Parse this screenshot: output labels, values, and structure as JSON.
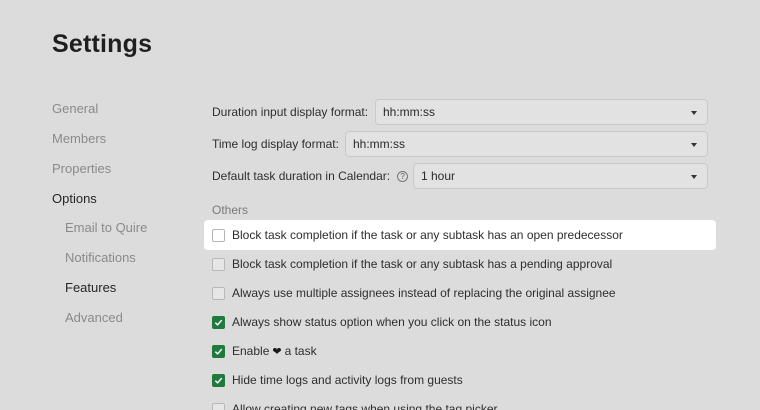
{
  "page": {
    "title": "Settings"
  },
  "sidebar": {
    "items": [
      {
        "label": "General",
        "active": false
      },
      {
        "label": "Members",
        "active": false
      },
      {
        "label": "Properties",
        "active": false
      },
      {
        "label": "Options",
        "active": true
      },
      {
        "label": "Email to Quire",
        "active": false
      },
      {
        "label": "Notifications",
        "active": false
      },
      {
        "label": "Features",
        "active": true
      },
      {
        "label": "Advanced",
        "active": false
      }
    ]
  },
  "fields": [
    {
      "label": "Duration input display format:",
      "value": "hh:mm:ss"
    },
    {
      "label": "Time log display format:",
      "value": "hh:mm:ss"
    },
    {
      "label": "Default task duration in Calendar:",
      "value": "1 hour",
      "help_icon": "?"
    }
  ],
  "section": {
    "label": "Others"
  },
  "options": [
    {
      "label": "Block task completion if the task or any subtask has an open predecessor",
      "checked": false,
      "highlighted": true
    },
    {
      "label": "Block task completion if the task or any subtask has a pending approval",
      "checked": false
    },
    {
      "label": "Always use multiple assignees instead of replacing the original assignee",
      "checked": false
    },
    {
      "label": "Always show status option when you click on the status icon",
      "checked": true
    },
    {
      "label_before": "Enable",
      "heart": "❤",
      "label_after": "a task",
      "checked": true
    },
    {
      "label": "Hide time logs and activity logs from guests",
      "checked": true
    },
    {
      "label": "Allow creating new tags when using the tag picker",
      "checked": false
    }
  ],
  "colors": {
    "background": "#dcdcdc",
    "check_green": "#1f7a3b",
    "highlight": "#ffffff"
  }
}
